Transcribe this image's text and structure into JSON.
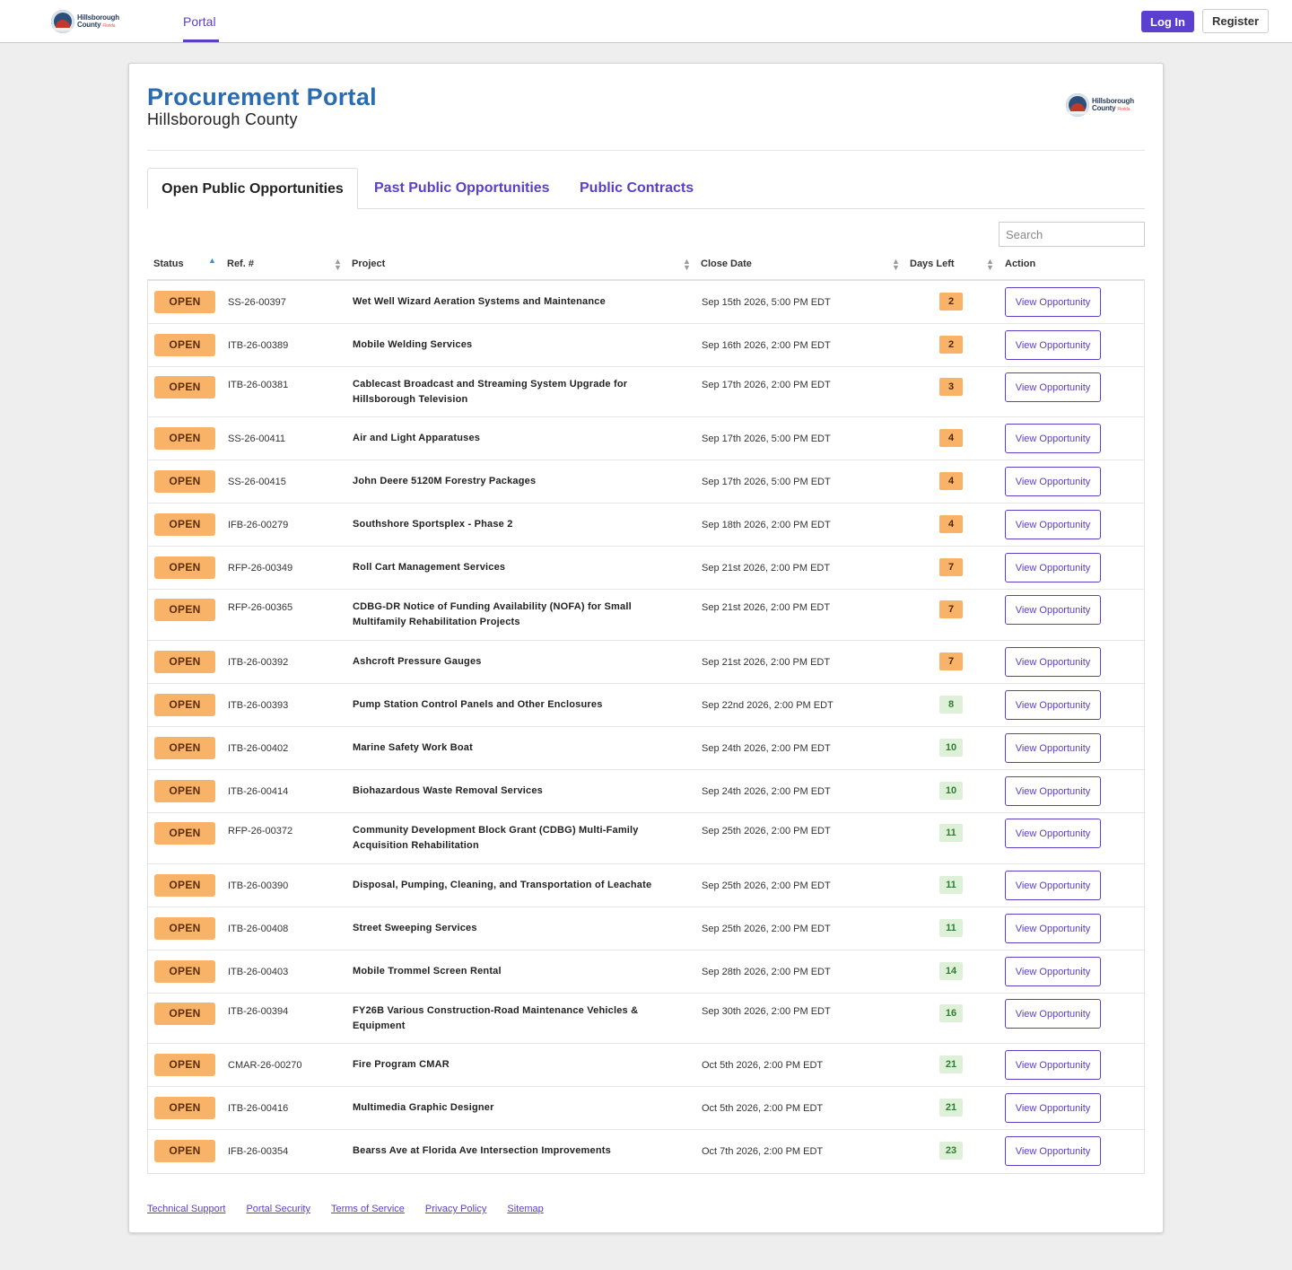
{
  "header": {
    "logo": {
      "line1": "Hillsborough",
      "line2": "County",
      "tag": "Florida"
    },
    "nav_portal": "Portal",
    "login_label": "Log In",
    "register_label": "Register",
    "accent_color": "#5b3fc7"
  },
  "page": {
    "title": "Procurement Portal",
    "subtitle": "Hillsborough County"
  },
  "tabs": [
    {
      "label": "Open Public Opportunities",
      "active": true
    },
    {
      "label": "Past Public Opportunities",
      "active": false
    },
    {
      "label": "Public Contracts",
      "active": false
    }
  ],
  "search": {
    "placeholder": "Search",
    "value": ""
  },
  "table": {
    "columns": [
      "Status",
      "Ref. #",
      "Project",
      "Close Date",
      "Days Left",
      "Action"
    ],
    "sorted_column": "Status",
    "rows": [
      {
        "status": "OPEN",
        "ref": "SS-26-00397",
        "project": "Wet Well Wizard Aeration Systems and Maintenance",
        "close_date": "Sep 15th 2026, 5:00 PM EDT",
        "days_left": "2",
        "action": "View Opportunity"
      },
      {
        "status": "OPEN",
        "ref": "ITB-26-00389",
        "project": "Mobile Welding Services",
        "close_date": "Sep 16th 2026, 2:00 PM EDT",
        "days_left": "2",
        "action": "View Opportunity"
      },
      {
        "status": "OPEN",
        "ref": "ITB-26-00381",
        "project": "Cablecast Broadcast and Streaming System Upgrade for Hillsborough Television",
        "close_date": "Sep 17th 2026, 2:00 PM EDT",
        "days_left": "3",
        "action": "View Opportunity"
      },
      {
        "status": "OPEN",
        "ref": "SS-26-00411",
        "project": "Air and Light Apparatuses",
        "close_date": "Sep 17th 2026, 5:00 PM EDT",
        "days_left": "4",
        "action": "View Opportunity"
      },
      {
        "status": "OPEN",
        "ref": "SS-26-00415",
        "project": "John Deere 5120M Forestry Packages",
        "close_date": "Sep 17th 2026, 5:00 PM EDT",
        "days_left": "4",
        "action": "View Opportunity"
      },
      {
        "status": "OPEN",
        "ref": "IFB-26-00279",
        "project": "Southshore Sportsplex - Phase 2",
        "close_date": "Sep 18th 2026, 2:00 PM EDT",
        "days_left": "4",
        "action": "View Opportunity"
      },
      {
        "status": "OPEN",
        "ref": "RFP-26-00349",
        "project": "Roll Cart Management Services",
        "close_date": "Sep 21st 2026, 2:00 PM EDT",
        "days_left": "7",
        "action": "View Opportunity"
      },
      {
        "status": "OPEN",
        "ref": "RFP-26-00365",
        "project": "CDBG-DR Notice of Funding Availability (NOFA) for Small Multifamily Rehabilitation Projects",
        "close_date": "Sep 21st 2026, 2:00 PM EDT",
        "days_left": "7",
        "action": "View Opportunity"
      },
      {
        "status": "OPEN",
        "ref": "ITB-26-00392",
        "project": "Ashcroft Pressure Gauges",
        "close_date": "Sep 21st 2026, 2:00 PM EDT",
        "days_left": "7",
        "action": "View Opportunity"
      },
      {
        "status": "OPEN",
        "ref": "ITB-26-00393",
        "project": "Pump Station Control Panels and Other Enclosures",
        "close_date": "Sep 22nd 2026, 2:00 PM EDT",
        "days_left": "8",
        "action": "View Opportunity"
      },
      {
        "status": "OPEN",
        "ref": "ITB-26-00402",
        "project": "Marine Safety Work Boat",
        "close_date": "Sep 24th 2026, 2:00 PM EDT",
        "days_left": "10",
        "action": "View Opportunity"
      },
      {
        "status": "OPEN",
        "ref": "ITB-26-00414",
        "project": "Biohazardous Waste Removal Services",
        "close_date": "Sep 24th 2026, 2:00 PM EDT",
        "days_left": "10",
        "action": "View Opportunity"
      },
      {
        "status": "OPEN",
        "ref": "RFP-26-00372",
        "project": "Community Development Block Grant (CDBG) Multi-Family Acquisition Rehabilitation",
        "close_date": "Sep 25th 2026, 2:00 PM EDT",
        "days_left": "11",
        "action": "View Opportunity"
      },
      {
        "status": "OPEN",
        "ref": "ITB-26-00390",
        "project": "Disposal, Pumping, Cleaning, and Transportation of Leachate",
        "close_date": "Sep 25th 2026, 2:00 PM EDT",
        "days_left": "11",
        "action": "View Opportunity"
      },
      {
        "status": "OPEN",
        "ref": "ITB-26-00408",
        "project": "Street Sweeping Services",
        "close_date": "Sep 25th 2026, 2:00 PM EDT",
        "days_left": "11",
        "action": "View Opportunity"
      },
      {
        "status": "OPEN",
        "ref": "ITB-26-00403",
        "project": "Mobile Trommel Screen Rental",
        "close_date": "Sep 28th 2026, 2:00 PM EDT",
        "days_left": "14",
        "action": "View Opportunity"
      },
      {
        "status": "OPEN",
        "ref": "ITB-26-00394",
        "project": "FY26B Various Construction-Road Maintenance Vehicles & Equipment",
        "close_date": "Sep 30th 2026, 2:00 PM EDT",
        "days_left": "16",
        "action": "View Opportunity"
      },
      {
        "status": "OPEN",
        "ref": "CMAR-26-00270",
        "project": "Fire Program CMAR",
        "close_date": "Oct 5th 2026, 2:00 PM EDT",
        "days_left": "21",
        "action": "View Opportunity"
      },
      {
        "status": "OPEN",
        "ref": "ITB-26-00416",
        "project": "Multimedia Graphic Designer",
        "close_date": "Oct 5th 2026, 2:00 PM EDT",
        "days_left": "21",
        "action": "View Opportunity"
      },
      {
        "status": "OPEN",
        "ref": "IFB-26-00354",
        "project": "Bearss Ave at Florida Ave Intersection Improvements",
        "close_date": "Oct 7th 2026, 2:00 PM EDT",
        "days_left": "23",
        "action": "View Opportunity"
      }
    ]
  },
  "footer": {
    "links": [
      "Technical Support",
      "Portal Security",
      "Terms of Service",
      "Privacy Policy",
      "Sitemap"
    ]
  }
}
